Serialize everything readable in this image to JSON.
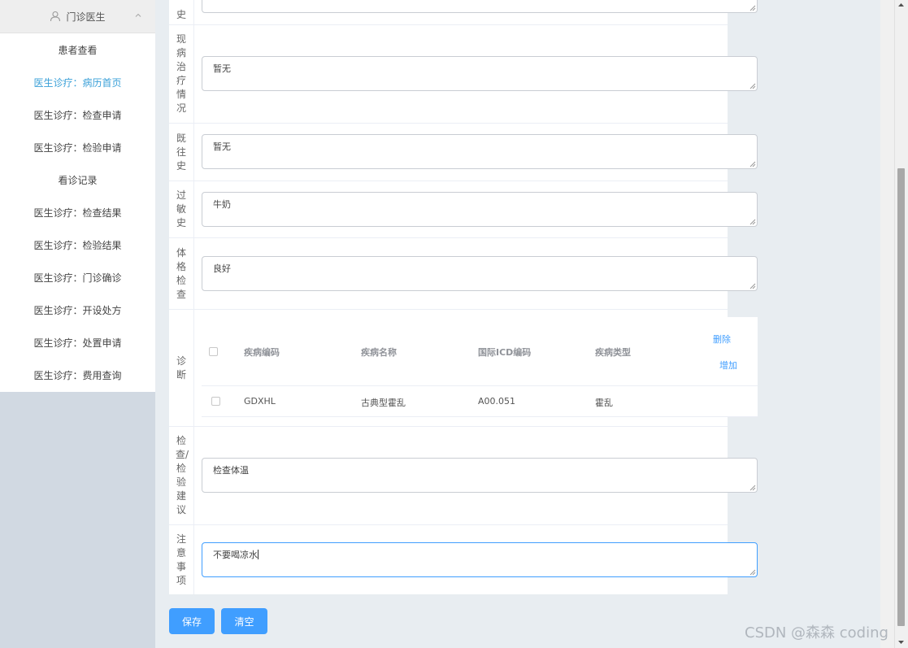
{
  "sidebar": {
    "header_label": "门诊医生",
    "items": [
      {
        "label": "患者查看"
      },
      {
        "label": "医生诊疗：病历首页"
      },
      {
        "label": "医生诊疗：检查申请"
      },
      {
        "label": "医生诊疗：检验申请"
      },
      {
        "label": "看诊记录"
      },
      {
        "label": "医生诊疗：检查结果"
      },
      {
        "label": "医生诊疗：检验结果"
      },
      {
        "label": "医生诊疗：门诊确诊"
      },
      {
        "label": "医生诊疗：开设处方"
      },
      {
        "label": "医生诊疗：处置申请"
      },
      {
        "label": "医生诊疗：费用查询"
      }
    ],
    "active_item": "医生诊疗：病历首页"
  },
  "form": {
    "top_partial_label": "史",
    "current_treatment": {
      "label": "现病治疗情况",
      "value": "暂无"
    },
    "past_history": {
      "label": "既往史",
      "value": "暂无"
    },
    "allergy": {
      "label": "过敏史",
      "value": "牛奶"
    },
    "physical_exam": {
      "label": "体格检查",
      "value": "良好"
    },
    "diagnosis": {
      "label": "诊断",
      "columns": [
        "疾病编码",
        "疾病名称",
        "国际ICD编码",
        "疾病类型"
      ],
      "delete_label": "删除",
      "add_label": "增加",
      "rows": [
        {
          "code": "GDXHL",
          "name": "古典型霍乱",
          "icd": "A00.051",
          "type": "霍乱"
        }
      ]
    },
    "exam_advice": {
      "label": "检查/检验建议",
      "value": "检查体温"
    },
    "notes": {
      "label": "注意事项",
      "value": "不要喝凉水"
    }
  },
  "buttons": {
    "save": "保存",
    "clear": "清空"
  },
  "watermark": "CSDN @森森 coding",
  "colors": {
    "accent": "#409eff",
    "sidebar_bg": "#d1d9e2",
    "page_bg": "#e8edf1"
  }
}
